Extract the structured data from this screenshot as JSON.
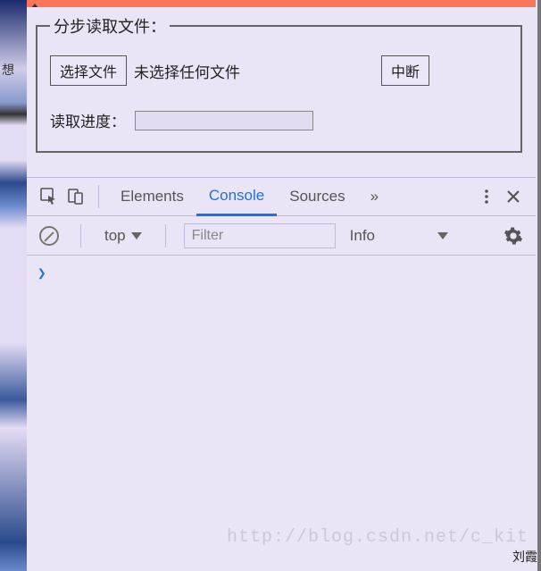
{
  "left_strip_text": "想",
  "fieldset": {
    "legend": "分步读取文件：",
    "choose_label": "选择文件",
    "file_status": "未选择任何文件",
    "abort_label": "中断",
    "progress_label": "读取进度："
  },
  "devtools": {
    "tabs": {
      "elements": "Elements",
      "console": "Console",
      "sources": "Sources",
      "more_indicator": "»"
    },
    "active_tab": "Console",
    "toolbar": {
      "context": "top",
      "filter_placeholder": "Filter",
      "level": "Info"
    },
    "prompt": "❯"
  },
  "watermark": "http://blog.csdn.net/c_kit",
  "author": "刘霞"
}
